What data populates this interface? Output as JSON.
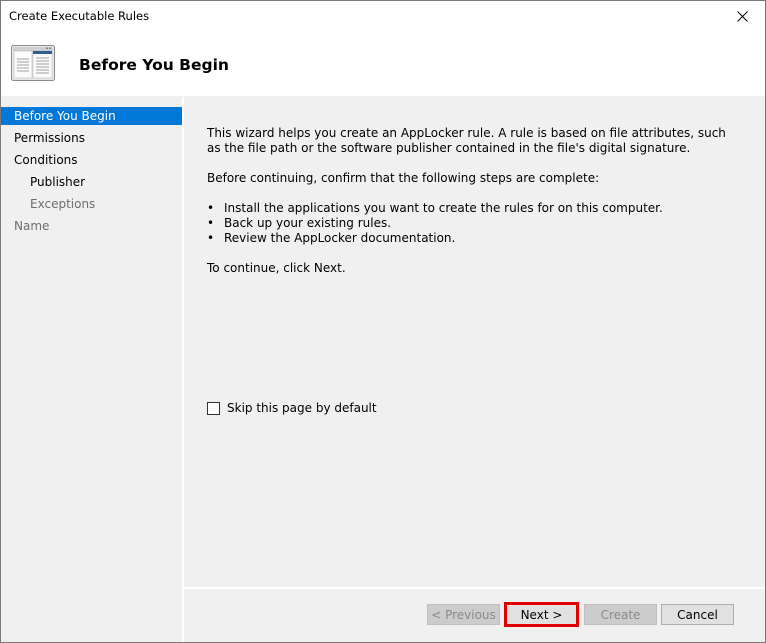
{
  "window": {
    "title": "Create Executable Rules",
    "close_icon": "close-icon"
  },
  "header": {
    "icon": "wizard-window-icon",
    "title": "Before You Begin"
  },
  "sidebar": {
    "items": [
      {
        "label": "Before You Begin",
        "state": "active"
      },
      {
        "label": "Permissions",
        "state": "enabled"
      },
      {
        "label": "Conditions",
        "state": "enabled"
      },
      {
        "label": "Publisher",
        "state": "enabled",
        "indent": true
      },
      {
        "label": "Exceptions",
        "state": "disabled",
        "indent": true
      },
      {
        "label": "Name",
        "state": "disabled"
      }
    ]
  },
  "content": {
    "intro": "This wizard helps you create an AppLocker rule. A rule is based on file attributes, such as the file path or the software publisher contained in the file's digital signature.",
    "confirm": "Before continuing, confirm that the following steps are complete:",
    "steps": [
      "Install the applications you want to create the rules for on this computer.",
      "Back up your existing rules.",
      "Review the AppLocker documentation."
    ],
    "continue_text": "To continue, click Next.",
    "skip_checkbox": {
      "label": "Skip this page by default",
      "checked": false
    }
  },
  "footer": {
    "previous_label": "< Previous",
    "next_label": "Next >",
    "create_label": "Create",
    "cancel_label": "Cancel"
  },
  "colors": {
    "accent": "#0078d7",
    "highlight_border": "#e00000",
    "background": "#f0f0f0"
  }
}
